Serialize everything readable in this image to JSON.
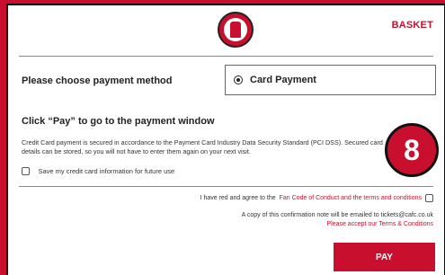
{
  "header": {
    "logo_text": "CHARLTON ATHLETIC",
    "basket_label": "BASKET"
  },
  "payment": {
    "choose_label": "Please choose payment method",
    "selected_method": "Card Payment",
    "pay_heading": "Click “Pay” to go to the payment window",
    "security_text": "Credit Card payment is secured in accordance to the Payment Card Industry Data Security Standard (PCI DSS). Secured card details can be stored, so you will not have to enter them again on your next visit.",
    "save_card_label": "Save my credit card information for future use",
    "save_card_checked": false
  },
  "annotation": {
    "step_number": "8"
  },
  "terms": {
    "agree_prefix": "I have red and agree to the",
    "agree_link": "Fan Code of Conduct and the terms and conditions",
    "agree_checked": false,
    "email_note": "A copy of this confirmation note will be emailed to tickets@cafc.co.uk",
    "accept_terms_text": "Please accept our Terms & Conditions"
  },
  "actions": {
    "pay_label": "PAY"
  },
  "colors": {
    "brand_red": "#c8102e",
    "text": "#222222"
  }
}
